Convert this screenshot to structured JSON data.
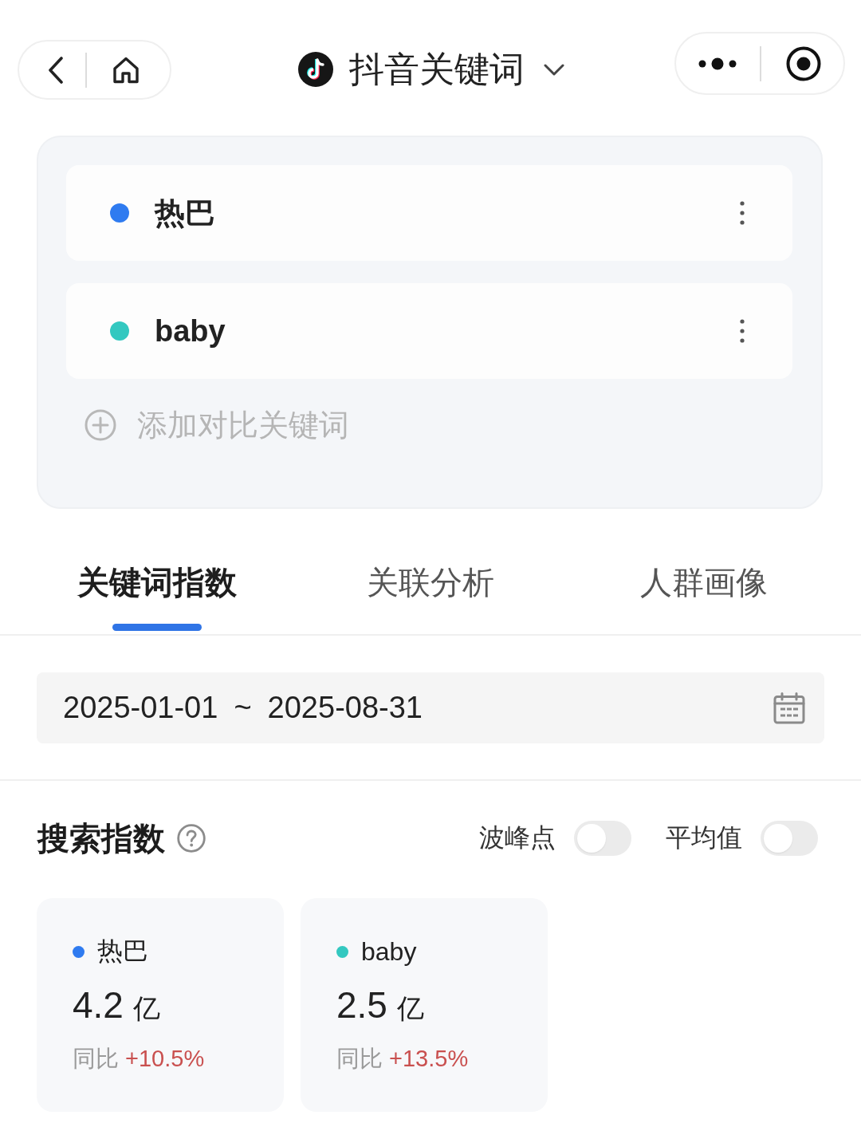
{
  "nav": {
    "title": "抖音关键词"
  },
  "keywords": [
    {
      "name": "热巴",
      "color": "#2f7bf0"
    },
    {
      "name": "baby",
      "color": "#33c8c0"
    }
  ],
  "add_keyword": {
    "label": "添加对比关键词"
  },
  "tabs": [
    {
      "label": "关键词指数",
      "selected": true
    },
    {
      "label": "关联分析",
      "selected": false
    },
    {
      "label": "人群画像",
      "selected": false
    }
  ],
  "date_range": {
    "start": "2025-01-01",
    "separator": "~",
    "end": "2025-08-31"
  },
  "search_index": {
    "title": "搜索指数",
    "toggles": [
      {
        "label": "波峰点",
        "on": false
      },
      {
        "label": "平均值",
        "on": false
      }
    ],
    "cards": [
      {
        "name": "热巴",
        "color": "#2f7bf0",
        "value": "4.2",
        "unit": "亿",
        "change_label": "同比",
        "change": "+10.5%"
      },
      {
        "name": "baby",
        "color": "#33c8c0",
        "value": "2.5",
        "unit": "亿",
        "change_label": "同比",
        "change": "+13.5%"
      }
    ]
  }
}
